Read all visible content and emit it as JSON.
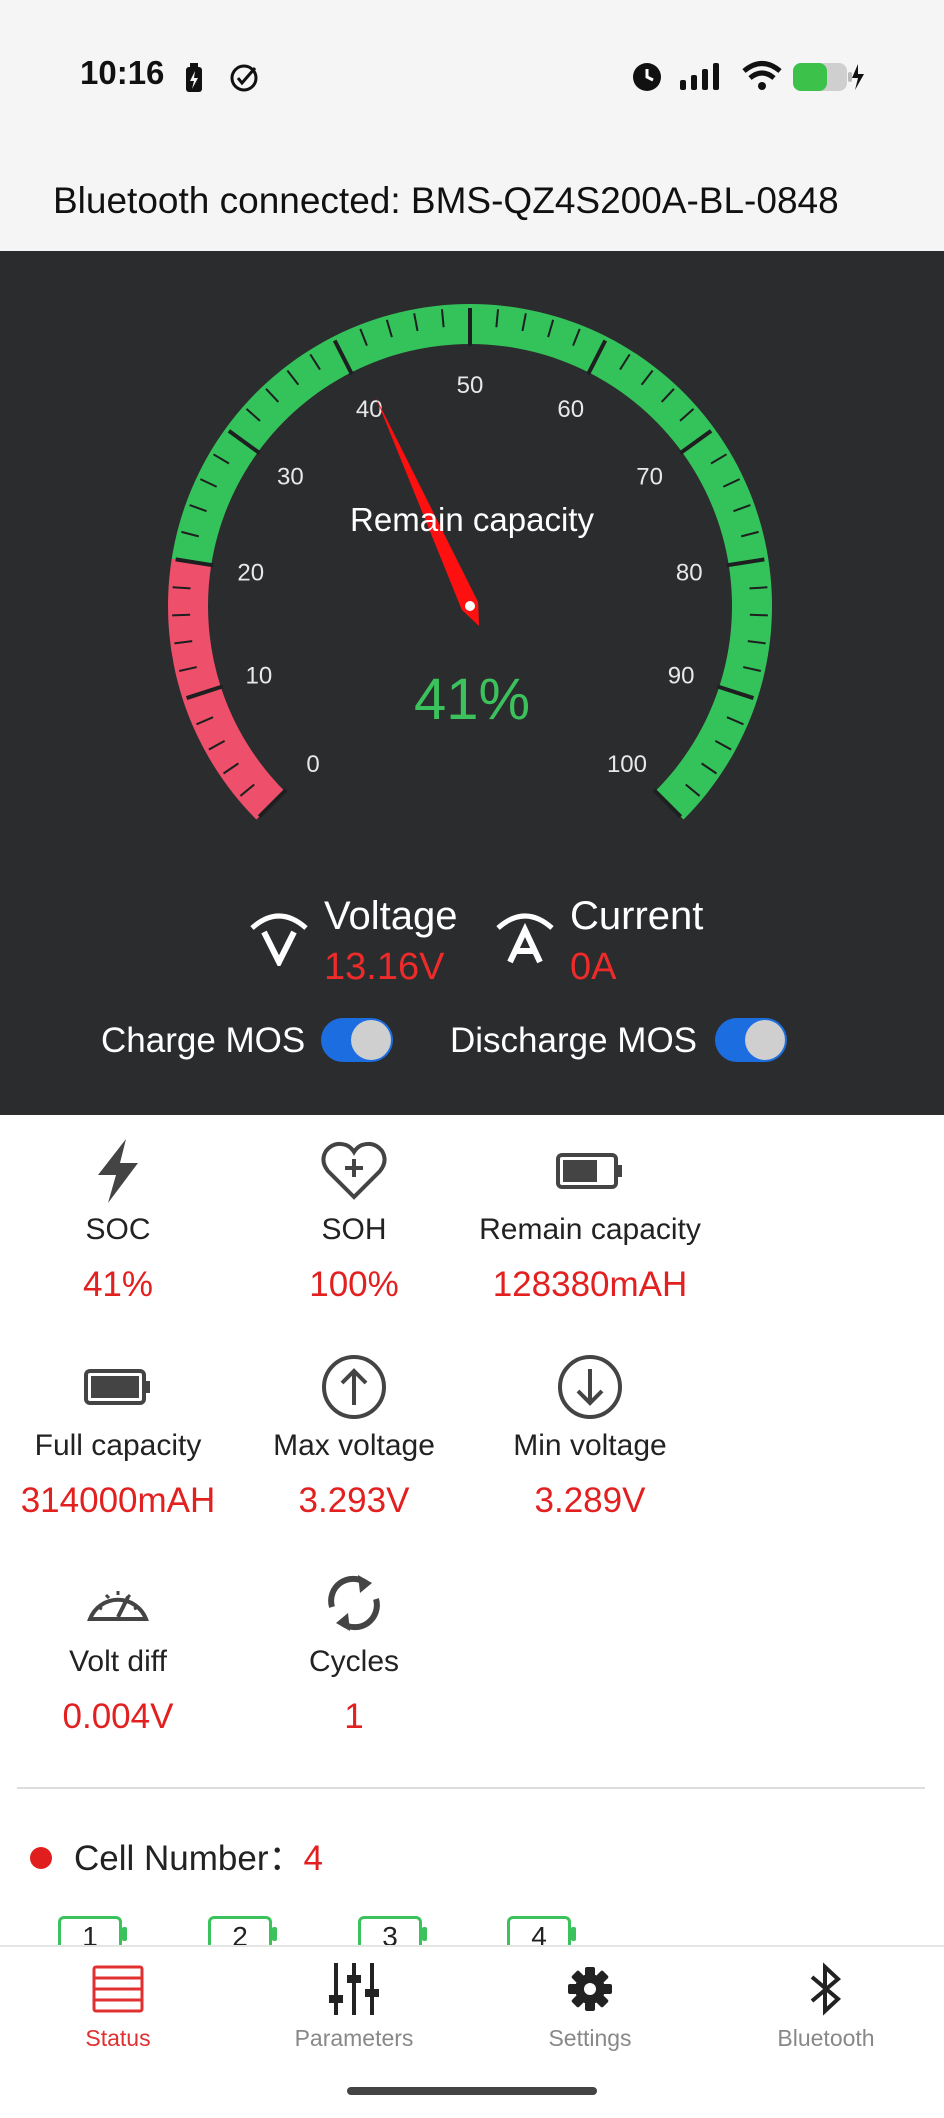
{
  "status_bar": {
    "time": "10:16",
    "icons": [
      "battery-saver-icon",
      "check-circle-icon",
      "alarm-icon",
      "signal-icon",
      "wifi-icon",
      "battery-charging-icon"
    ]
  },
  "connection": {
    "text": "Bluetooth connected: BMS-QZ4S200A-BL-0848"
  },
  "gauge": {
    "title": "Remain capacity",
    "value_text": "41%",
    "value": 41,
    "min": 0,
    "max": 100,
    "tick_labels": [
      "0",
      "10",
      "20",
      "30",
      "40",
      "50",
      "60",
      "70",
      "80",
      "90",
      "100"
    ],
    "red_until": 20,
    "colors": {
      "low": "#ee4f6a",
      "normal": "#34c25a",
      "needle": "#ff1010"
    }
  },
  "readings": {
    "voltage_label": "Voltage",
    "voltage_value": "13.16V",
    "current_label": "Current",
    "current_value": "0A"
  },
  "mos": {
    "charge_label": "Charge MOS",
    "charge_on": true,
    "discharge_label": "Discharge MOS",
    "discharge_on": true
  },
  "stats": {
    "soc": {
      "name": "SOC",
      "value": "41%"
    },
    "soh": {
      "name": "SOH",
      "value": "100%"
    },
    "remain": {
      "name": "Remain capacity",
      "value": "128380mAH"
    },
    "full": {
      "name": "Full capacity",
      "value": "314000mAH"
    },
    "maxv": {
      "name": "Max voltage",
      "value": "3.293V"
    },
    "minv": {
      "name": "Min voltage",
      "value": "3.289V"
    },
    "vdiff": {
      "name": "Volt diff",
      "value": "0.004V"
    },
    "cycles": {
      "name": "Cycles",
      "value": "1"
    }
  },
  "cells": {
    "label": "Cell Number：",
    "count": "4",
    "items": [
      "1",
      "2",
      "3",
      "4"
    ]
  },
  "nav": {
    "status": "Status",
    "parameters": "Parameters",
    "settings": "Settings",
    "bluetooth": "Bluetooth",
    "active_color": "#e03030"
  }
}
